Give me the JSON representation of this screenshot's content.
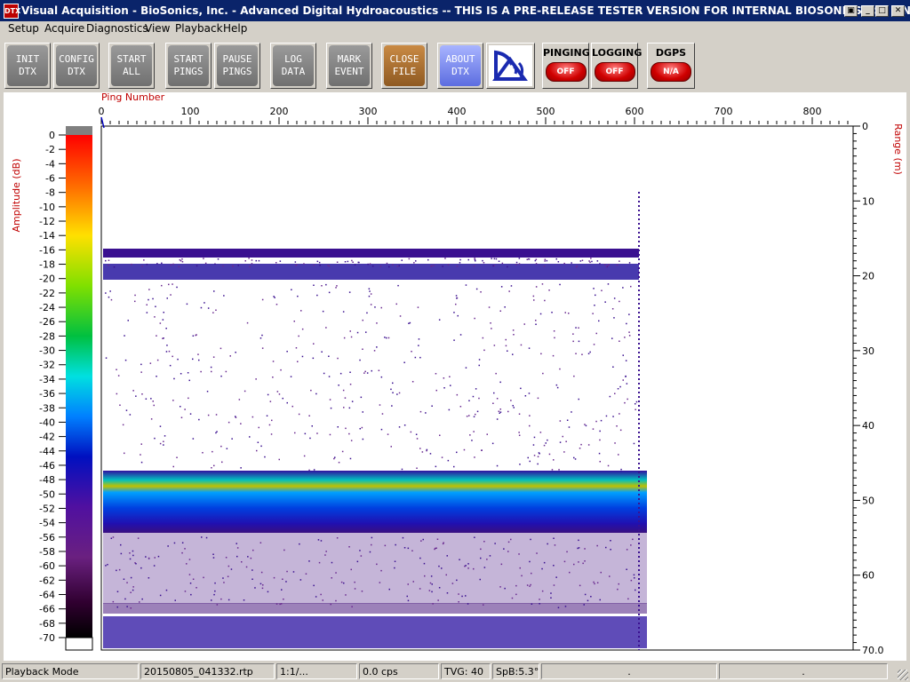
{
  "window": {
    "icon_text": "DTX",
    "title": "Visual Acquisition  -  BioSonics, Inc.  -  Advanced Digital Hydroacoustics  -- THIS IS A PRE-RELEASE TESTER VERSION FOR INTERNAL BIOSONICS USE ONLY"
  },
  "menu": [
    "Setup",
    "Acquire",
    "Diagnostics",
    "View",
    "Playback",
    "Help"
  ],
  "toolbar": {
    "buttons": [
      {
        "line1": "INIT",
        "line2": "DTX"
      },
      {
        "line1": "CONFIG",
        "line2": "DTX"
      },
      {
        "line1": "START",
        "line2": "ALL"
      },
      {
        "line1": "START",
        "line2": "PINGS"
      },
      {
        "line1": "PAUSE",
        "line2": "PINGS"
      },
      {
        "line1": "LOG",
        "line2": "DATA"
      },
      {
        "line1": "MARK",
        "line2": "EVENT"
      },
      {
        "line1": "CLOSE",
        "line2": "FILE"
      },
      {
        "line1": "ABOUT",
        "line2": "DTX"
      }
    ],
    "indicators": [
      {
        "label": "PINGING",
        "state": "OFF"
      },
      {
        "label": "LOGGING",
        "state": "OFF"
      },
      {
        "label": "DGPS",
        "state": "N/A"
      }
    ]
  },
  "plot": {
    "x_axis_label": "Ping Number",
    "x_ticks": [
      "0",
      "100",
      "200",
      "300",
      "400",
      "500",
      "600",
      "700",
      "800"
    ],
    "y_axis_label": "Range (m)",
    "y_ticks": [
      "0",
      "10",
      "20",
      "30",
      "40",
      "50",
      "60",
      "70.0"
    ],
    "amp_label": "Amplitude (dB)",
    "amp_ticks": [
      "0",
      "-2",
      "-4",
      "-6",
      "-8",
      "-10",
      "-12",
      "-14",
      "-16",
      "-18",
      "-20",
      "-22",
      "-24",
      "-26",
      "-28",
      "-30",
      "-32",
      "-34",
      "-36",
      "-38",
      "-40",
      "-42",
      "-44",
      "-46",
      "-48",
      "-50",
      "-52",
      "-54",
      "-56",
      "-58",
      "-60",
      "-62",
      "-64",
      "-66",
      "-68",
      "-70"
    ]
  },
  "status": {
    "mode": "Playback Mode",
    "file": "20150805_041332.rtp",
    "ratio": "1:1/...",
    "cps": "0.0 cps",
    "tvg": "TVG: 40",
    "spb": "SpB:5.3°",
    "extra1": ".",
    "extra2": "."
  }
}
